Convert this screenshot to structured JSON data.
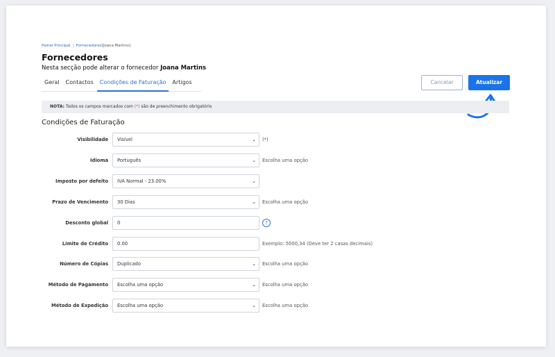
{
  "breadcrumb": {
    "home": "Painel Principal",
    "separator": "|",
    "section": "Fornecedores",
    "current": "[Joana Martins]"
  },
  "page": {
    "title": "Fornecedores",
    "subtitle_prefix": "Nesta secção pode alterar o fornecedor",
    "subtitle_name": "Joana Martins"
  },
  "tabs": [
    {
      "label": "Geral",
      "active": false
    },
    {
      "label": "Contactos",
      "active": false
    },
    {
      "label": "Condições de Faturação",
      "active": true
    },
    {
      "label": "Artigos",
      "active": false
    }
  ],
  "actions": {
    "cancel_label": "Cancelar",
    "update_label": "Atualizar"
  },
  "note": {
    "bold": "NOTA:",
    "text_before": "Todos os campos marcados com",
    "marker": "(*)",
    "text_after": "são de preenchimento obrigatório"
  },
  "section_title": "Condições de Faturação",
  "form": {
    "visibilidade": {
      "label": "Visibilidade",
      "value": "Visível",
      "hint": "(*)"
    },
    "idioma": {
      "label": "Idioma",
      "value": "Português",
      "hint": "Escolha uma opção"
    },
    "imposto": {
      "label": "Imposto por defeito",
      "value": "IVA Normal - 23.00%"
    },
    "prazo": {
      "label": "Prazo de Vencimento",
      "value": "30 Dias",
      "hint": "Escolha uma opção"
    },
    "desconto": {
      "label": "Desconto global",
      "value": "0",
      "help": "?"
    },
    "limite": {
      "label": "Limite de Crédito",
      "value": "0.00",
      "hint": "Exemplo: 5000,34 (Deve ter 2 casas decimais)"
    },
    "copias": {
      "label": "Número de Cópias",
      "value": "Duplicado",
      "hint": "Escolha uma opção"
    },
    "pagamento": {
      "label": "Método de Pagamento",
      "value": "Escolha uma opção",
      "hint": "Escolha uma opção"
    },
    "expedicao": {
      "label": "Método de Expedição",
      "value": "Escolha uma opção",
      "hint": "Escolha uma opção"
    }
  },
  "icons": {
    "select_chevron": "chevron-down-icon",
    "pointer_arrow": "curved-arrow-icon"
  },
  "colors": {
    "accent": "#1a73e8",
    "required": "#e05454",
    "note_bg": "#eceef2"
  }
}
